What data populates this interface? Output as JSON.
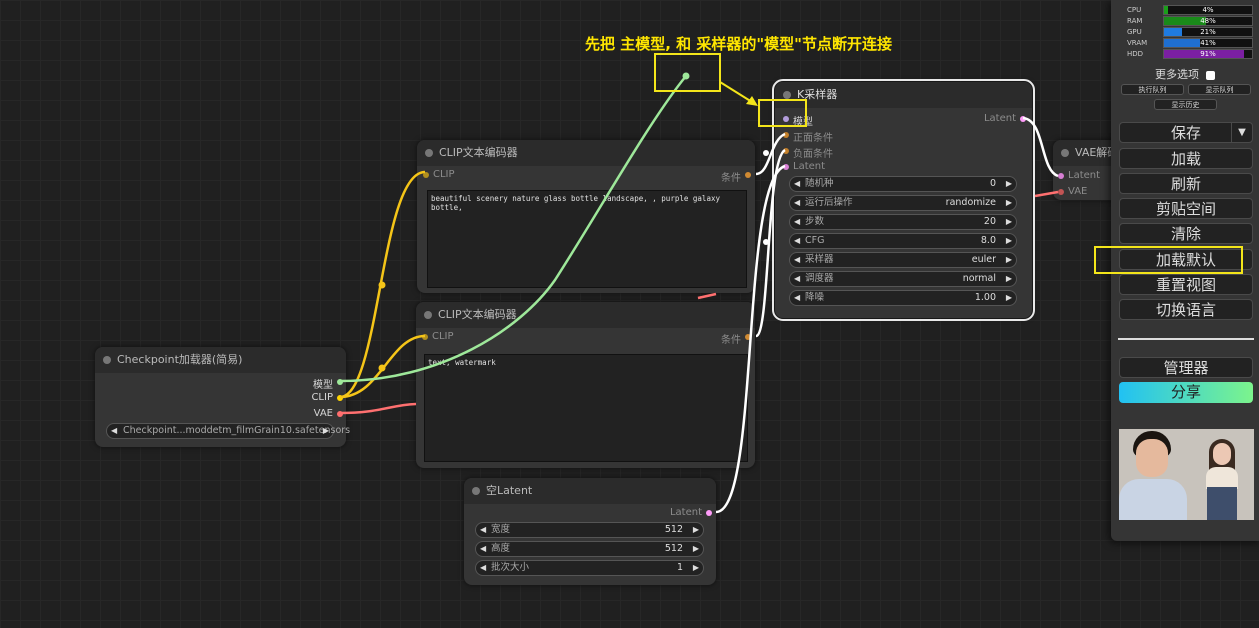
{
  "annotation": {
    "text": "先把 主模型, 和 采样器的\"模型\"节点断开连接"
  },
  "nodes": {
    "clip_top": {
      "title": "CLIP文本编码器",
      "input_clip": "CLIP",
      "output": "条件",
      "prompt": "beautiful scenery nature glass bottle landscape, , purple galaxy bottle,"
    },
    "clip_bottom": {
      "title": "CLIP文本编码器",
      "input_clip": "CLIP",
      "output": "条件",
      "prompt": "text, watermark"
    },
    "checkpoint": {
      "title": "Checkpoint加载器(简易)",
      "out_model": "模型",
      "out_clip": "CLIP",
      "out_vae": "VAE",
      "ckpt_value": "Checkpoint...moddetm_filmGrain10.safetensors"
    },
    "ksampler": {
      "title": "K采样器",
      "in_model": "模型",
      "in_positive": "正面条件",
      "in_negative": "负面条件",
      "in_latent": "Latent",
      "out_latent": "Latent",
      "widgets": [
        {
          "label": "随机种",
          "value": "0"
        },
        {
          "label": "运行后操作",
          "value": "randomize"
        },
        {
          "label": "步数",
          "value": "20"
        },
        {
          "label": "CFG",
          "value": "8.0"
        },
        {
          "label": "采样器",
          "value": "euler"
        },
        {
          "label": "调度器",
          "value": "normal"
        },
        {
          "label": "降噪",
          "value": "1.00"
        }
      ]
    },
    "empty_latent": {
      "title": "空Latent",
      "out_latent": "Latent",
      "widgets": [
        {
          "label": "宽度",
          "value": "512"
        },
        {
          "label": "高度",
          "value": "512"
        },
        {
          "label": "批次大小",
          "value": "1"
        }
      ]
    },
    "vae_decode": {
      "title": "VAE解码",
      "in_latent": "Latent",
      "in_vae": "VAE"
    }
  },
  "menu": {
    "monitors": [
      {
        "label": "CPU",
        "value": "4%",
        "fraction": 0.04,
        "color": "#1a9e1a"
      },
      {
        "label": "RAM",
        "value": "48%",
        "fraction": 0.48,
        "color": "#1a8a1a"
      },
      {
        "label": "GPU",
        "value": "21%",
        "fraction": 0.21,
        "color": "#1f7be0"
      },
      {
        "label": "VRAM",
        "value": "41%",
        "fraction": 0.41,
        "color": "#1f6fd0"
      },
      {
        "label": "HDD",
        "value": "91%",
        "fraction": 0.91,
        "color": "#7b1fa2"
      }
    ],
    "more_options": "更多选项",
    "queue_view": "执行队列",
    "queue_show": "显示队列",
    "history": "显示历史",
    "save": "保存",
    "load": "加载",
    "refresh": "刷新",
    "clipspace": "剪贴空间",
    "clear": "清除",
    "load_default": "加载默认",
    "reset_view": "重置视图",
    "switch_language": "切换语言",
    "manager": "管理器",
    "share": "分享",
    "dropdown_arrow": "▼"
  },
  "colors": {
    "model": "#b39ddb",
    "clip": "#ffd500",
    "vae": "#ff6e6e",
    "conditioning": "#ffa931",
    "latent": "#ff9cf9",
    "annotation": "#f3e51a"
  }
}
